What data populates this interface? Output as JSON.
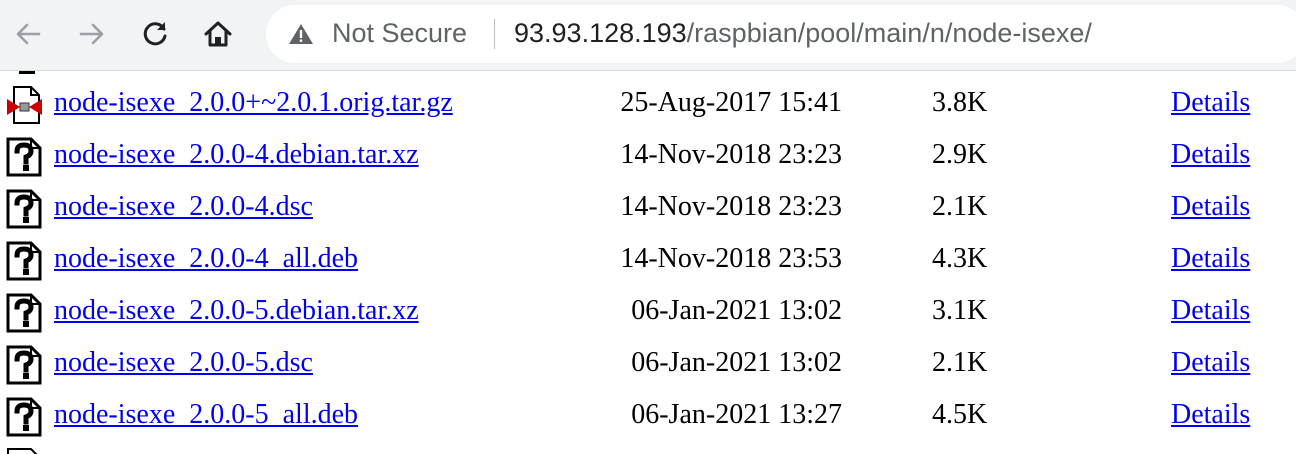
{
  "browser": {
    "security_label": "Not Secure",
    "url_host": "93.93.128.193",
    "url_path": "/raspbian/pool/main/n/node-isexe/"
  },
  "files": [
    {
      "name": "node-isexe_2.0.0+~2.0.1.orig.tar.gz",
      "date": "25-Aug-2017 15:41",
      "size": "3.8K",
      "details": "Details",
      "icon": "compressed-file-icon"
    },
    {
      "name": "node-isexe_2.0.0-4.debian.tar.xz",
      "date": "14-Nov-2018 23:23",
      "size": "2.9K",
      "details": "Details",
      "icon": "unknown-file-icon"
    },
    {
      "name": "node-isexe_2.0.0-4.dsc",
      "date": "14-Nov-2018 23:23",
      "size": "2.1K",
      "details": "Details",
      "icon": "unknown-file-icon"
    },
    {
      "name": "node-isexe_2.0.0-4_all.deb",
      "date": "14-Nov-2018 23:53",
      "size": "4.3K",
      "details": "Details",
      "icon": "unknown-file-icon"
    },
    {
      "name": "node-isexe_2.0.0-5.debian.tar.xz",
      "date": "06-Jan-2021 13:02",
      "size": "3.1K",
      "details": "Details",
      "icon": "unknown-file-icon"
    },
    {
      "name": "node-isexe_2.0.0-5.dsc",
      "date": "06-Jan-2021 13:02",
      "size": "2.1K",
      "details": "Details",
      "icon": "unknown-file-icon"
    },
    {
      "name": "node-isexe_2.0.0-5_all.deb",
      "date": "06-Jan-2021 13:27",
      "size": "4.5K",
      "details": "Details",
      "icon": "unknown-file-icon"
    }
  ]
}
